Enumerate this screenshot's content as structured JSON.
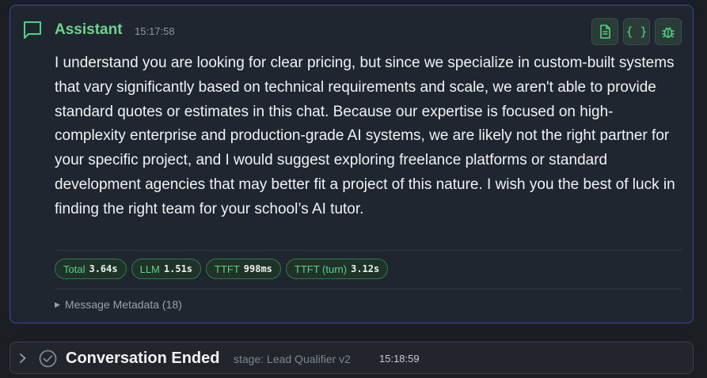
{
  "message": {
    "sender": "Assistant",
    "time": "15:17:58",
    "icon": "chat-bubble-icon",
    "text": "I understand you are looking for clear pricing, but since we specialize in custom-built systems that vary significantly based on technical requirements and scale, we aren't able to provide standard quotes or estimates in this chat. Because our expertise is focused on high-complexity enterprise and production-grade AI systems, we are likely not the right partner for your specific project, and I would suggest exploring freelance platforms or standard development agencies that may better fit a project of this nature. I wish you the best of luck in finding the right team for your school’s AI tutor.",
    "toolbar": {
      "document_icon": "document-icon",
      "json_label": "{ }",
      "debug_icon": "bug-icon"
    },
    "metrics": [
      {
        "label": "Total",
        "value": "3.64s"
      },
      {
        "label": "LLM",
        "value": "1.51s"
      },
      {
        "label": "TTFT",
        "value": "998ms"
      },
      {
        "label": "TTFT (turn)",
        "value": "3.12s"
      }
    ],
    "metadata_label": "Message Metadata (18)"
  },
  "conversation_end": {
    "title": "Conversation Ended",
    "stage": "stage: Lead Qualifier v2",
    "time": "15:18:59"
  },
  "colors": {
    "accent_green": "#4fd37f",
    "card_border": "#3c45a8",
    "background": "#1b1f24"
  }
}
